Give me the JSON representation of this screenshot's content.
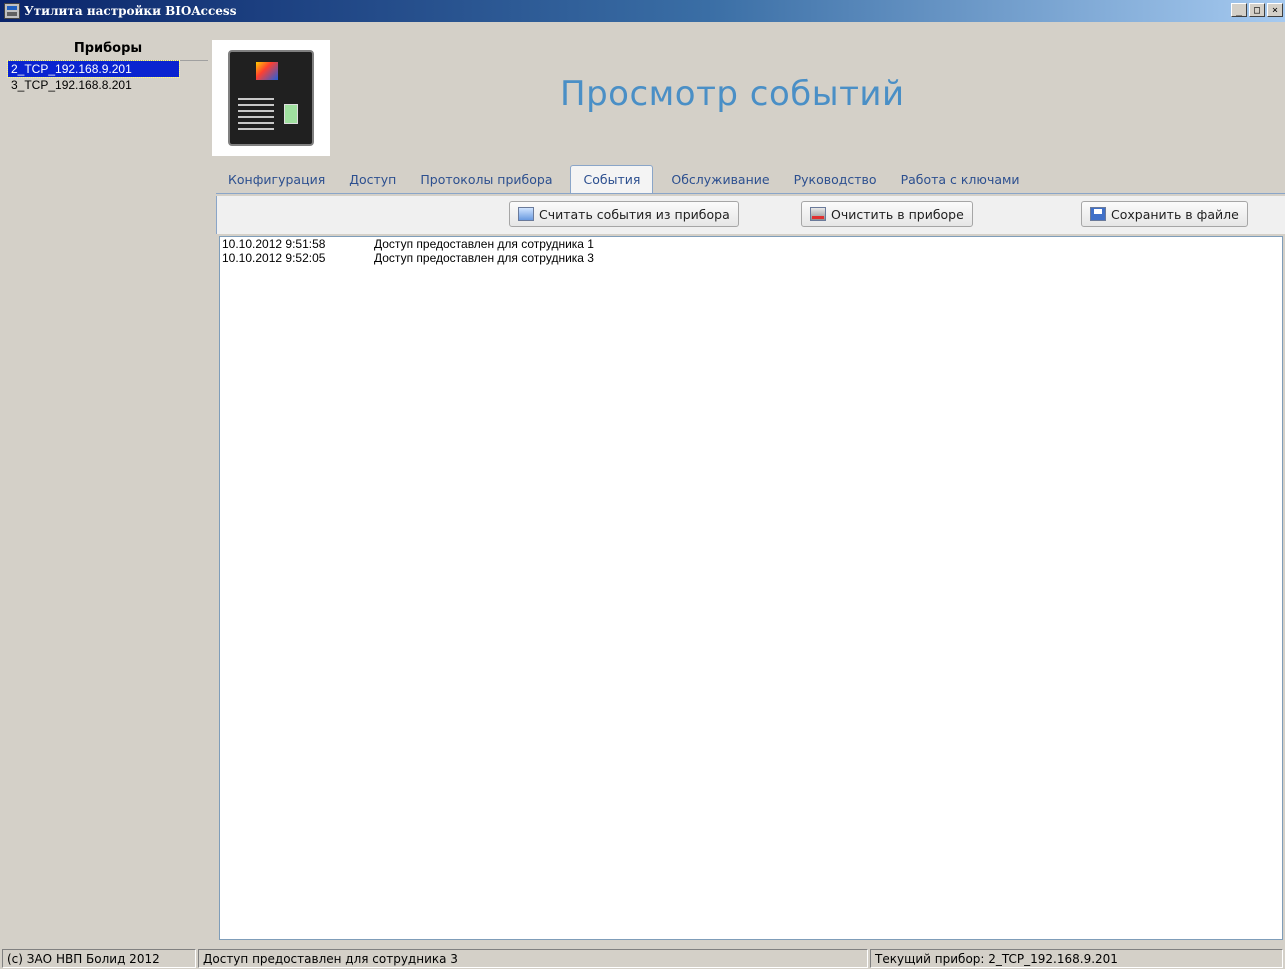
{
  "window": {
    "title": "Утилита настройки BIOAccess",
    "controls": {
      "minimize": "_",
      "maximize": "□",
      "close": "×"
    }
  },
  "devices": {
    "header": "Приборы",
    "items": [
      {
        "label": "2_TCP_192.168.9.201",
        "selected": true
      },
      {
        "label": "3_TCP_192.168.8.201",
        "selected": false
      }
    ]
  },
  "header": {
    "device_image_icon": "fingerprint-terminal-icon",
    "title": "Просмотр событий"
  },
  "tabs": [
    {
      "label": "Конфигурация",
      "active": false
    },
    {
      "label": "Доступ",
      "active": false
    },
    {
      "label": "Протоколы прибора",
      "active": false
    },
    {
      "label": "События",
      "active": true
    },
    {
      "label": "Обслуживание",
      "active": false
    },
    {
      "label": "Руководство",
      "active": false
    },
    {
      "label": "Работа с ключами",
      "active": false
    }
  ],
  "toolbar": {
    "read_label": "Считать события из прибора",
    "clear_label": "Очистить в приборе",
    "save_label": "Сохранить в файле"
  },
  "events": [
    {
      "timestamp": "10.10.2012 9:51:58",
      "message": "Доступ предоставлен для сотрудника 1"
    },
    {
      "timestamp": "10.10.2012 9:52:05",
      "message": "Доступ предоставлен для сотрудника 3"
    }
  ],
  "status": {
    "copyright": "(c) ЗАО НВП Болид 2012",
    "last_event": "Доступ предоставлен для сотрудника 3",
    "current_device": "Текущий прибор: 2_TCP_192.168.9.201"
  }
}
